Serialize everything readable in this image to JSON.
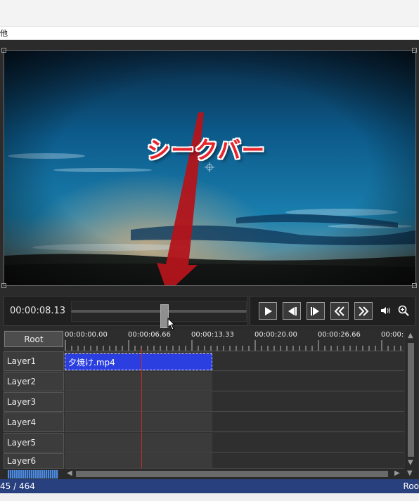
{
  "menu": {
    "item": "他"
  },
  "preview": {
    "annotation": "シークバー",
    "crosshair_icon": "crosshair-icon"
  },
  "controls": {
    "time": "00:00:08.13",
    "seek_position": 0.52,
    "buttons": [
      "play-icon",
      "prev-frame-icon",
      "next-frame-icon",
      "rewind-icon",
      "fast-forward-icon",
      "volume-icon",
      "zoom-icon"
    ]
  },
  "timeline": {
    "root_label": "Root",
    "ticks": [
      "00:00:00.00",
      "00:00:06.66",
      "00:00:13.33",
      "00:00:20.00",
      "00:00:26.66",
      "00:00:"
    ],
    "layers": [
      "Layer1",
      "Layer2",
      "Layer3",
      "Layer4",
      "Layer5",
      "Layer6"
    ],
    "clip_label": "夕焼け.mp4"
  },
  "status": {
    "left": "45 / 464",
    "right": "Roo"
  },
  "colors": {
    "status_bar": "#29407f",
    "clip": "#2b3fe0",
    "playhead": "#c12a2a",
    "annotation": "#e8242c"
  }
}
